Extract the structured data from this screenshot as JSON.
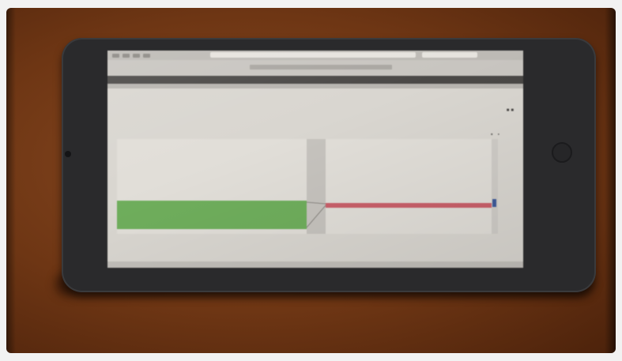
{
  "browser": {
    "url": "",
    "tab_title": ""
  },
  "app_nav": {
    "items": [
      "",
      "",
      "",
      ""
    ],
    "right": ""
  },
  "view_tabs": [
    "",
    ""
  ],
  "section": {
    "title": ""
  },
  "files": [
    {
      "label": ""
    },
    {
      "label": ""
    },
    {
      "label": ""
    }
  ],
  "diff": {
    "toolbar": {
      "labels": [
        "",
        ""
      ],
      "button": ""
    },
    "left_lines": [
      "",
      "",
      "",
      "",
      "",
      ""
    ],
    "right_lines": [
      "",
      "",
      "",
      "",
      "",
      ""
    ],
    "added_lines": [
      "",
      "",
      ""
    ]
  },
  "status": {
    "left": "",
    "right": ""
  },
  "colors": {
    "added": "#6fae5c",
    "removed": "#c9606a",
    "scroll_thumb": "#3e5a9a"
  }
}
